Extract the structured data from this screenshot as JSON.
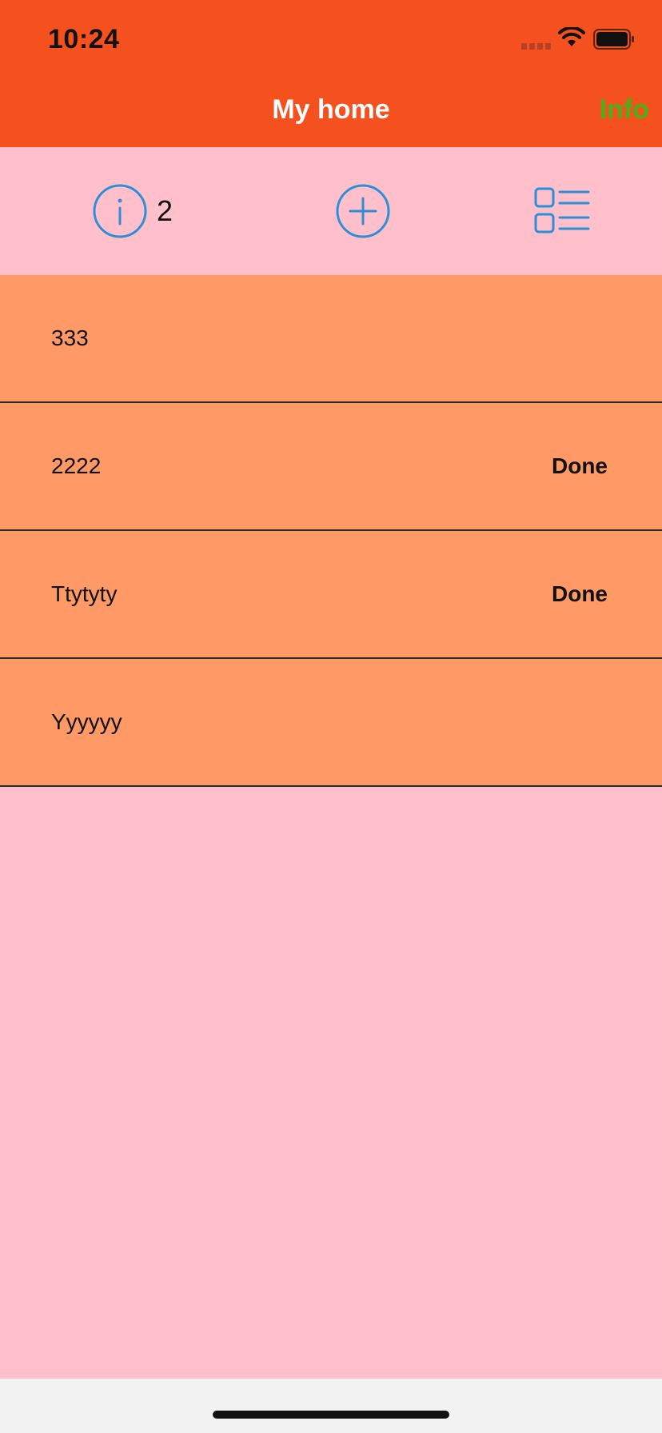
{
  "status_bar": {
    "time": "10:24"
  },
  "nav": {
    "title": "My home",
    "info_label": "Info"
  },
  "toolbar": {
    "info_count": "2"
  },
  "list": {
    "rows": [
      {
        "label": "333",
        "status": ""
      },
      {
        "label": "2222",
        "status": "Done"
      },
      {
        "label": "Ttytyty",
        "status": "Done"
      },
      {
        "label": "Yyyyyy",
        "status": ""
      }
    ]
  },
  "colors": {
    "header_bg": "#f5511f",
    "toolbar_bg": "#ffc0cb",
    "row_bg": "#ff9966",
    "accent_icon": "#2e8fd9",
    "info_link": "#4caf1a"
  },
  "icons": {
    "info": "info-circle-icon",
    "add": "plus-circle-icon",
    "list": "list-view-icon",
    "wifi": "wifi-icon",
    "battery": "battery-icon",
    "signal": "cellular-signal-icon"
  }
}
